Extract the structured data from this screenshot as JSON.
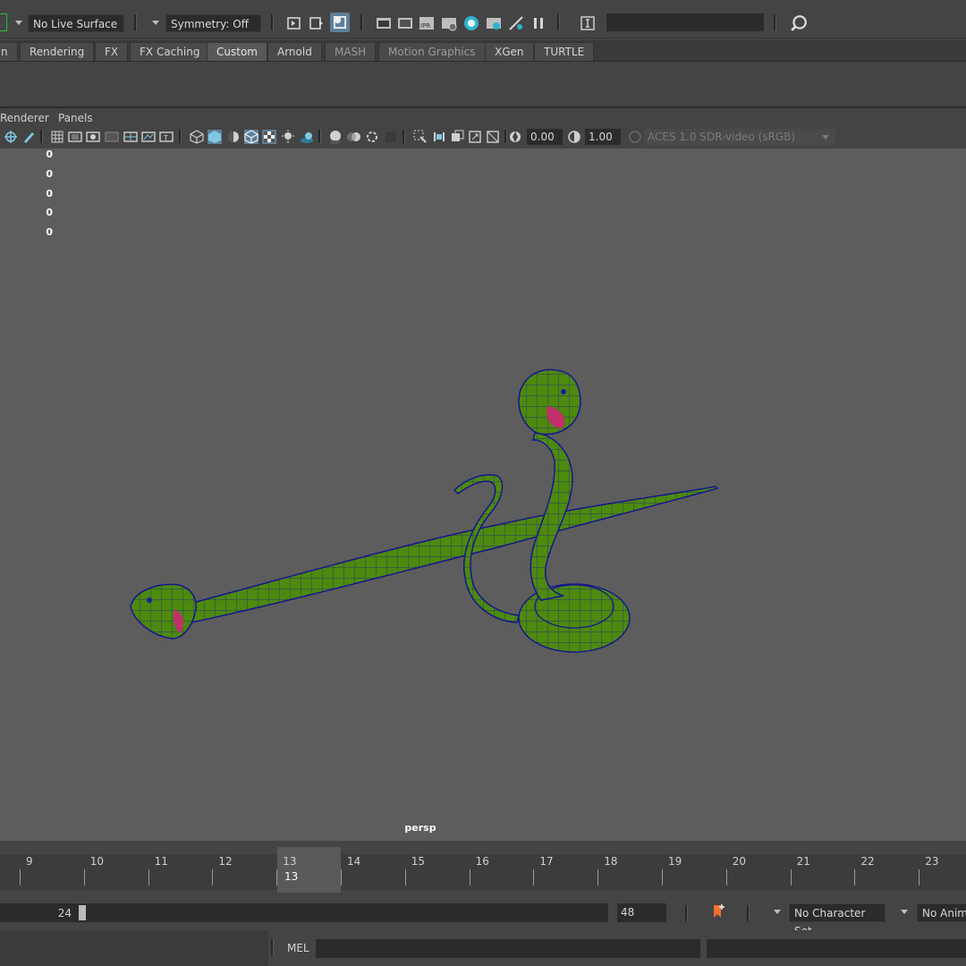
{
  "status_line": {
    "live_surface": "No Live Surface",
    "symmetry": "Symmetry: Off"
  },
  "shelf": {
    "tabs": [
      {
        "label": "n"
      },
      {
        "label": "Rendering"
      },
      {
        "label": "FX"
      },
      {
        "label": "FX Caching"
      },
      {
        "label": "Custom"
      },
      {
        "label": "Arnold"
      },
      {
        "label": "MASH"
      },
      {
        "label": "Motion Graphics"
      },
      {
        "label": "XGen"
      },
      {
        "label": "TURTLE"
      }
    ],
    "active": "Custom"
  },
  "panel": {
    "menus": [
      "Renderer",
      "Panels"
    ],
    "exposure": "0.00",
    "gamma": "1.00",
    "color_space": "ACES 1.0 SDR-video (sRGB)"
  },
  "viewport": {
    "hud_values": [
      "0",
      "0",
      "0",
      "0",
      "0"
    ],
    "camera": "persp",
    "object_colors": {
      "body": "#4d8a0e",
      "wire": "#1a1aa0",
      "mouth": "#c0306a"
    }
  },
  "timeline": {
    "frames": [
      "9",
      "10",
      "11",
      "12",
      "13",
      "14",
      "15",
      "16",
      "17",
      "18",
      "19",
      "20",
      "21",
      "22",
      "23"
    ],
    "current_frame": "13"
  },
  "range": {
    "end_frame": "24",
    "anim_end": "48",
    "character_set": "No Character Set",
    "anim_layer": "No Anim"
  },
  "command_line": {
    "language": "MEL"
  }
}
